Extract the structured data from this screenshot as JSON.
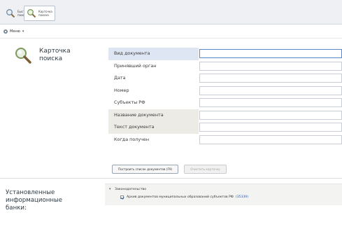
{
  "toolbar": {
    "quick_search": "Быстрый\nпоиск",
    "search_card": "Карточка\nпоиска"
  },
  "menu": {
    "label": "Меню"
  },
  "card": {
    "title": "Карточка\nпоиска"
  },
  "fields": [
    {
      "label": "Вид документа"
    },
    {
      "label": "Принявший орган"
    },
    {
      "label": "Дата"
    },
    {
      "label": "Номер"
    },
    {
      "label": "Субъекты РФ"
    },
    {
      "label": "Название документа"
    },
    {
      "label": "Текст документа"
    },
    {
      "label": "Когда получен"
    }
  ],
  "actions": {
    "build_list": "Построить список документов (F9)",
    "clear_card": "Очистить карточку"
  },
  "banks": {
    "title": "Установленные\nинформационные\nбанки:",
    "group_label": "Законодательство",
    "item_label": "Архив документов муниципальных образований субъектов РФ",
    "item_count": "(35339)"
  },
  "colors": {
    "accent": "#5a86c8",
    "label_highlight_blue": "#dfe6f3",
    "label_highlight_grey": "#ecebe6",
    "count_link": "#2a5ab0"
  }
}
